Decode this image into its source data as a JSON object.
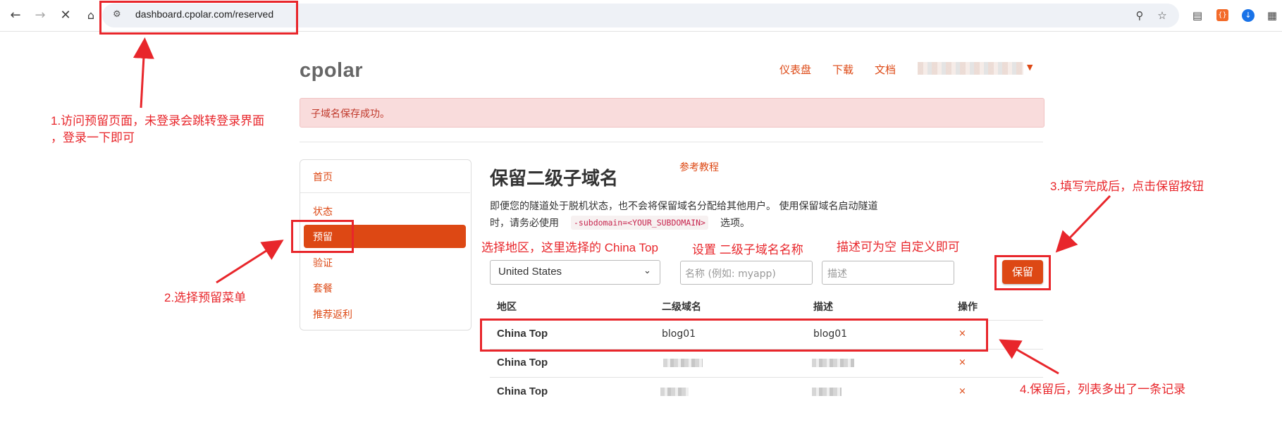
{
  "browser": {
    "url": "dashboard.cpolar.com/reserved",
    "nav_icons": [
      "back-arrow-icon",
      "forward-arrow-icon",
      "close-icon",
      "home-icon"
    ],
    "toolbar_icons": [
      "zoom-icon",
      "star-icon",
      "reading-list-icon",
      "json-extension-icon",
      "download-icon",
      "extensions-icon"
    ]
  },
  "header": {
    "brand": "cpolar",
    "nav": [
      "仪表盘",
      "下载",
      "文档"
    ]
  },
  "alert": {
    "text": "子域名保存成功。"
  },
  "sidebar": {
    "items": [
      "首页",
      "状态",
      "预留",
      "验证",
      "套餐",
      "推荐返利"
    ],
    "active": "预留"
  },
  "main": {
    "title": "保留二级子域名",
    "tutorial_link": "参考教程",
    "desc_line1": "即便您的隧道处于脱机状态，也不会将保留域名分配给其他用户。 使用保留域名启动隧道",
    "desc_line2_prefix": "时，请务必使用",
    "code": "-subdomain=<YOUR_SUBDOMAIN>",
    "desc_line2_suffix": "选项。"
  },
  "form": {
    "region_selected": "United States",
    "name_placeholder": "名称 (例如: myapp)",
    "desc_placeholder": "描述",
    "save_label": "保留"
  },
  "table": {
    "headers": [
      "地区",
      "二级域名",
      "描述",
      "操作"
    ],
    "rows": [
      {
        "region": "China Top",
        "subdomain": "blog01",
        "description": "blog01",
        "action": "×"
      },
      {
        "region": "China Top",
        "subdomain": "",
        "description": "",
        "action": "×"
      },
      {
        "region": "China Top",
        "subdomain": "",
        "description": "",
        "action": "×"
      }
    ]
  },
  "annotations": {
    "step1_line1": "1.访问预留页面，未登录会跳转登录界面",
    "step1_line2": "，登录一下即可",
    "step2": "2.选择预留菜单",
    "step3": "3.填写完成后，点击保留按钮",
    "step4": "4.保留后，列表多出了一条记录",
    "region_hint": "选择地区，这里选择的 China Top",
    "name_hint": "设置 二级子域名名称",
    "desc_hint": "描述可为空 自定义即可",
    "color": "#e8262b"
  },
  "colors": {
    "accent": "#dd4814",
    "alert_bg": "#f9dcdc"
  }
}
